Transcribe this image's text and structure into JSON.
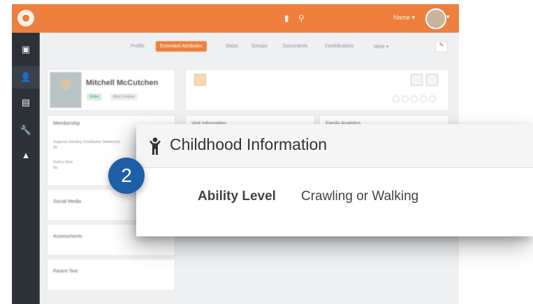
{
  "topbar": {
    "user_label": "Name ▾",
    "caret": "▾"
  },
  "sidebar": {
    "items": [
      "▣",
      "👤",
      "▤",
      "🔧",
      "▲"
    ]
  },
  "tabs": [
    "Profile",
    "Extended Attributes",
    "Steps",
    "Groups",
    "Documents",
    "Contributions",
    "More ▾"
  ],
  "edit_icon": "✎",
  "person": {
    "name": "Mitchell McCutchen",
    "badges": [
      "Visitor",
      "Main Campus"
    ]
  },
  "cards": {
    "membership": {
      "title": "Membership",
      "line1_label": "Suppress Sending Contribution Statements",
      "line1_value": "No",
      "line2_label": "Prefers Here",
      "line2_value": "No"
    },
    "visit": {
      "title": "Visit Information"
    },
    "family": {
      "title": "Family Analytics"
    },
    "social": {
      "title": "Social Media"
    },
    "assessments": {
      "title": "Assessments"
    },
    "parent_text": {
      "title": "Parent Text"
    }
  },
  "overlay": {
    "title": "Childhood Information",
    "field_label": "Ability Level",
    "field_value": "Crawling or Walking",
    "step_number": "2",
    "icon": "child-icon"
  },
  "colors": {
    "accent": "#ee7f3d",
    "sidebar": "#2d3238",
    "step_badge": "#1f5fa8"
  }
}
